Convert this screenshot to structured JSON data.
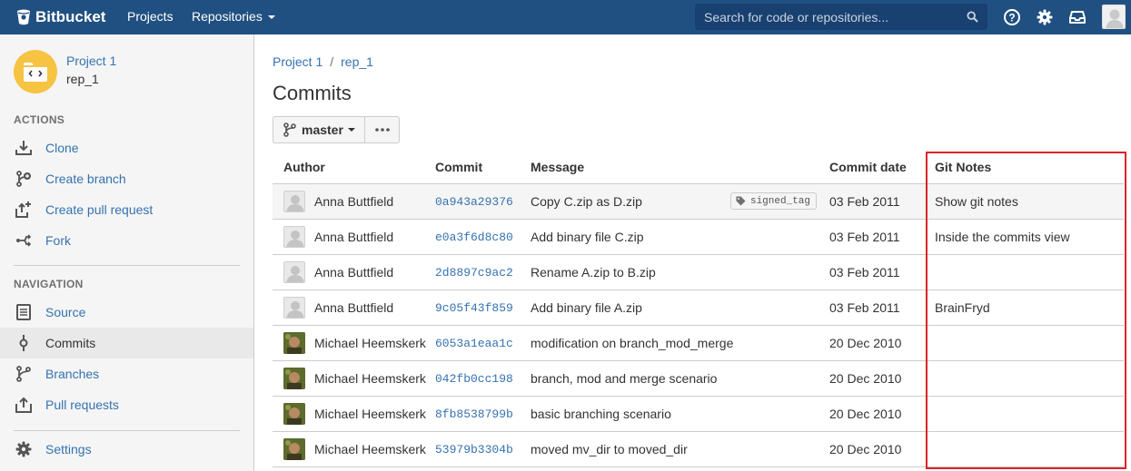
{
  "header": {
    "logo_text": "Bitbucket",
    "nav": {
      "projects": "Projects",
      "repositories": "Repositories"
    },
    "search_placeholder": "Search for code or repositories...",
    "brand_color": "#205081"
  },
  "sidebar": {
    "project_name": "Project 1",
    "repo_name": "rep_1",
    "actions_title": "ACTIONS",
    "actions": [
      {
        "label": "Clone",
        "icon": "clone-icon"
      },
      {
        "label": "Create branch",
        "icon": "create-branch-icon"
      },
      {
        "label": "Create pull request",
        "icon": "create-pull-request-icon"
      },
      {
        "label": "Fork",
        "icon": "fork-icon"
      }
    ],
    "navigation_title": "NAVIGATION",
    "navigation": [
      {
        "label": "Source",
        "icon": "source-icon"
      },
      {
        "label": "Commits",
        "icon": "commits-icon",
        "active": true
      },
      {
        "label": "Branches",
        "icon": "branches-icon"
      },
      {
        "label": "Pull requests",
        "icon": "pull-requests-icon"
      }
    ],
    "settings_label": "Settings"
  },
  "breadcrumb": {
    "project": "Project 1",
    "separator": "/",
    "repo": "rep_1"
  },
  "page_title": "Commits",
  "branch_selector": {
    "label": "master"
  },
  "table": {
    "headers": {
      "author": "Author",
      "commit": "Commit",
      "message": "Message",
      "date": "Commit date",
      "notes": "Git Notes"
    },
    "rows": [
      {
        "author": "Anna Buttfield",
        "hash": "0a943a29376",
        "message": "Copy C.zip as D.zip",
        "tag": "signed_tag",
        "date": "03 Feb 2011",
        "notes": "Show git notes"
      },
      {
        "author": "Anna Buttfield",
        "hash": "e0a3f6d8c80",
        "message": "Add binary file C.zip",
        "tag": "",
        "date": "03 Feb 2011",
        "notes": "Inside the commits view"
      },
      {
        "author": "Anna Buttfield",
        "hash": "2d8897c9ac2",
        "message": "Rename A.zip to B.zip",
        "tag": "",
        "date": "03 Feb 2011",
        "notes": ""
      },
      {
        "author": "Anna Buttfield",
        "hash": "9c05f43f859",
        "message": "Add binary file A.zip",
        "tag": "",
        "date": "03 Feb 2011",
        "notes": "BrainFryd"
      },
      {
        "author": "Michael Heemskerk",
        "hash": "6053a1eaa1c",
        "message": "modification on branch_mod_merge",
        "tag": "",
        "date": "20 Dec 2010",
        "notes": ""
      },
      {
        "author": "Michael Heemskerk",
        "hash": "042fb0cc198",
        "message": "branch, mod and merge scenario",
        "tag": "",
        "date": "20 Dec 2010",
        "notes": ""
      },
      {
        "author": "Michael Heemskerk",
        "hash": "8fb8538799b",
        "message": "basic branching scenario",
        "tag": "",
        "date": "20 Dec 2010",
        "notes": ""
      },
      {
        "author": "Michael Heemskerk",
        "hash": "53979b3304b",
        "message": "moved mv_dir to moved_dir",
        "tag": "",
        "date": "20 Dec 2010",
        "notes": ""
      }
    ]
  },
  "colors": {
    "link": "#3572b0",
    "highlight": "#d9242a",
    "project_avatar": "#f6c342"
  }
}
